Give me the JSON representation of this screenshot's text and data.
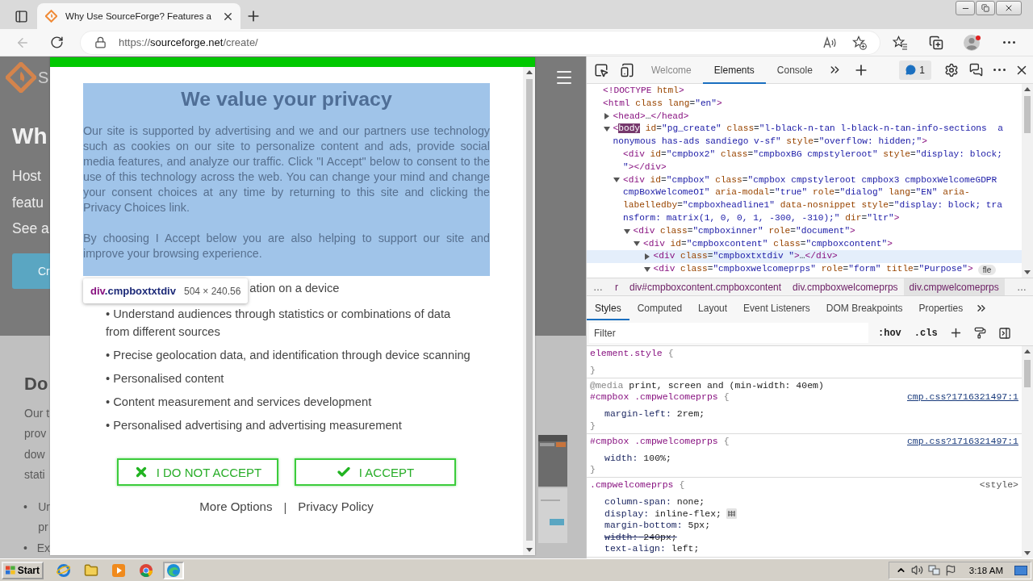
{
  "browser": {
    "tab": {
      "title": "Why Use SourceForge? Features a",
      "selected": true
    },
    "url": {
      "scheme": "https://",
      "host": "sourceforge.net",
      "path": "/create/"
    }
  },
  "page": {
    "logo_text": "S",
    "hero": {
      "heading": "Wh",
      "lines": [
        "Host",
        "featu",
        "See a"
      ],
      "button": "Cr"
    },
    "section": {
      "heading": "Do",
      "lines": [
        "Our t",
        "prov",
        "dow",
        "stati"
      ],
      "bullets": [
        {
          "marker": "•",
          "lines": [
            "Ur",
            "pr"
          ]
        },
        {
          "marker": "•",
          "lines": [
            "Ex"
          ]
        }
      ]
    }
  },
  "modal": {
    "title": "We value your privacy",
    "paragraphs": [
      "Our site is supported by advertising and we and our partners use technology such as cookies on our site to personalize content and ads, provide social media features, and analyze our traffic. Click \"I Accept\" below to consent to the use of this technology across the web. You can change your mind and change your consent choices at any time by returning to this site and clicking the Privacy Choices link.",
      "By choosing I Accept below you are also helping to support our site and improve your browsing experience."
    ],
    "purposes": [
      "ation on a device",
      "• Understand audiences through statistics or combinations of data from different sources",
      "• Precise geolocation data, and identification through device scanning",
      "• Personalised content",
      "• Content measurement and services development",
      "• Personalised advertising and advertising measurement"
    ],
    "buttons": [
      {
        "kind": "reject",
        "label": "I DO NOT ACCEPT"
      },
      {
        "kind": "accept",
        "label": "I ACCEPT"
      }
    ],
    "links": [
      "More Options",
      "Privacy Policy"
    ],
    "link_separator": "|"
  },
  "inspect_tooltip": {
    "tag": "div",
    "class_name": ".cmpboxtxtdiv",
    "size": "504 × 240.56"
  },
  "devtools": {
    "tabs": [
      {
        "label": "Welcome",
        "selected": false
      },
      {
        "label": "Elements",
        "selected": true
      },
      {
        "label": "Console",
        "selected": false
      }
    ],
    "issues": "1",
    "dom_tree": [
      {
        "lines": [
          "<!DOCTYPE html>"
        ],
        "hovered": false
      },
      {
        "lines": [
          "<html class lang=\"en\">"
        ],
        "hovered": false,
        "children": [
          {
            "lines": [
              "<head>…</head>"
            ],
            "expanded": false,
            "hovered": false
          },
          {
            "lines": [
              {
                "segments": [
                  {
                    "text": "<",
                    "highlighted": false
                  },
                  {
                    "text": "body",
                    "highlighted": true
                  },
                  {
                    "text": " id=\"pg_create\" class=\"l-black-n-tan l-black-n-tan-info-sections  a",
                    "highlighted": false
                  }
                ]
              },
              "nonymous has-ads sandiego v-sf\" style=\"overflow: hidden;\">"
            ],
            "expanded": true,
            "hovered": false,
            "children": [
              {
                "lines": [
                  "<div id=\"cmpbox2\" class=\"cmpboxBG cmpstyleroot\" style=\"display: block;",
                  "\"></div>"
                ],
                "hovered": false
              },
              {
                "lines": [
                  "<div id=\"cmpbox\" class=\"cmpbox cmpstyleroot cmpbox3 cmpboxWelcomeGDPR",
                  "cmpBoxWelcomeOI\" aria-modal=\"true\" role=\"dialog\" lang=\"EN\" aria-",
                  "labelledby=\"cmpboxheadline1\" data-nosnippet style=\"display: block; tra",
                  "nsform: matrix(1, 0, 0, 1, -300, -310);\" dir=\"ltr\">"
                ],
                "expanded": true,
                "hovered": false,
                "children": [
                  {
                    "lines": [
                      "<div class=\"cmpboxinner\" role=\"document\">"
                    ],
                    "expanded": true,
                    "hovered": false,
                    "children": [
                      {
                        "lines": [
                          "<div id=\"cmpboxcontent\" class=\"cmpboxcontent\">"
                        ],
                        "expanded": true,
                        "hovered": false,
                        "children": [
                          {
                            "lines": [
                              "<div class=\"cmpboxtxtdiv \">…</div>"
                            ],
                            "expanded": false,
                            "hovered": true
                          },
                          {
                            "lines": [
                              "<div class=\"cmpboxwelcomeprps\" role=\"form\" title=\"Purpose\">"
                            ],
                            "expanded": true,
                            "hovered": false,
                            "badge": "fle"
                          }
                        ]
                      }
                    ]
                  }
                ]
              }
            ]
          }
        ]
      }
    ],
    "breadcrumbs": {
      "lead": "…",
      "items": [
        {
          "label": "r",
          "selected": false
        },
        {
          "label": "div#cmpboxcontent.cmpboxcontent",
          "selected": false
        },
        {
          "label": "div.cmpboxwelcomeprps",
          "selected": false
        },
        {
          "label": "div.cmpwelcomeprps",
          "selected": true
        }
      ],
      "trail": "…"
    },
    "pane_tabs": [
      {
        "label": "Styles",
        "selected": true
      },
      {
        "label": "Computed",
        "selected": false
      },
      {
        "label": "Layout",
        "selected": false
      },
      {
        "label": "Event Listeners",
        "selected": false
      },
      {
        "label": "DOM Breakpoints",
        "selected": false
      },
      {
        "label": "Properties",
        "selected": false
      }
    ],
    "filter": {
      "placeholder": "Filter"
    },
    "filter_toggles": [
      ":hov",
      ".cls"
    ],
    "rules": [
      {
        "selector": "element.style",
        "open": "{",
        "close": "}"
      },
      {
        "media": {
          "keyword": "@media",
          "query": "print, screen and (min-width: 40em)"
        },
        "selector": "#cmpbox .cmpwelcomeprps",
        "open": "{",
        "source": "cmp.css?1716321497:1",
        "declarations": [
          {
            "property": "margin-left:",
            "value": "2rem;",
            "overridden": false
          }
        ],
        "close": "}"
      },
      {
        "selector": "#cmpbox .cmpwelcomeprps",
        "open": "{",
        "source": "cmp.css?1716321497:1",
        "declarations": [
          {
            "property": "width:",
            "value": "100%;",
            "overridden": false
          }
        ],
        "close": "}"
      },
      {
        "selector": ".cmpwelcomeprps",
        "open": "{",
        "source": "<style>",
        "declarations": [
          {
            "property": "column-span:",
            "value": "none;",
            "overridden": false
          },
          {
            "property": "display:",
            "value": "inline-flex;",
            "overridden": false,
            "flex_editor": true
          },
          {
            "property": "margin-bottom:",
            "value": "5px;",
            "overridden": false
          },
          {
            "property": "width:",
            "value": "240px;",
            "overridden": true
          },
          {
            "property": "text-align:",
            "value": "left;",
            "overridden": false
          }
        ]
      }
    ]
  },
  "taskbar": {
    "start": "Start",
    "apps": [
      {
        "kind": "globe",
        "active": false
      },
      {
        "kind": "folder",
        "active": false
      },
      {
        "kind": "player",
        "active": false
      },
      {
        "kind": "tricolor",
        "active": false
      },
      {
        "kind": "swirl",
        "active": true
      }
    ],
    "clock": "3:18 AM"
  }
}
